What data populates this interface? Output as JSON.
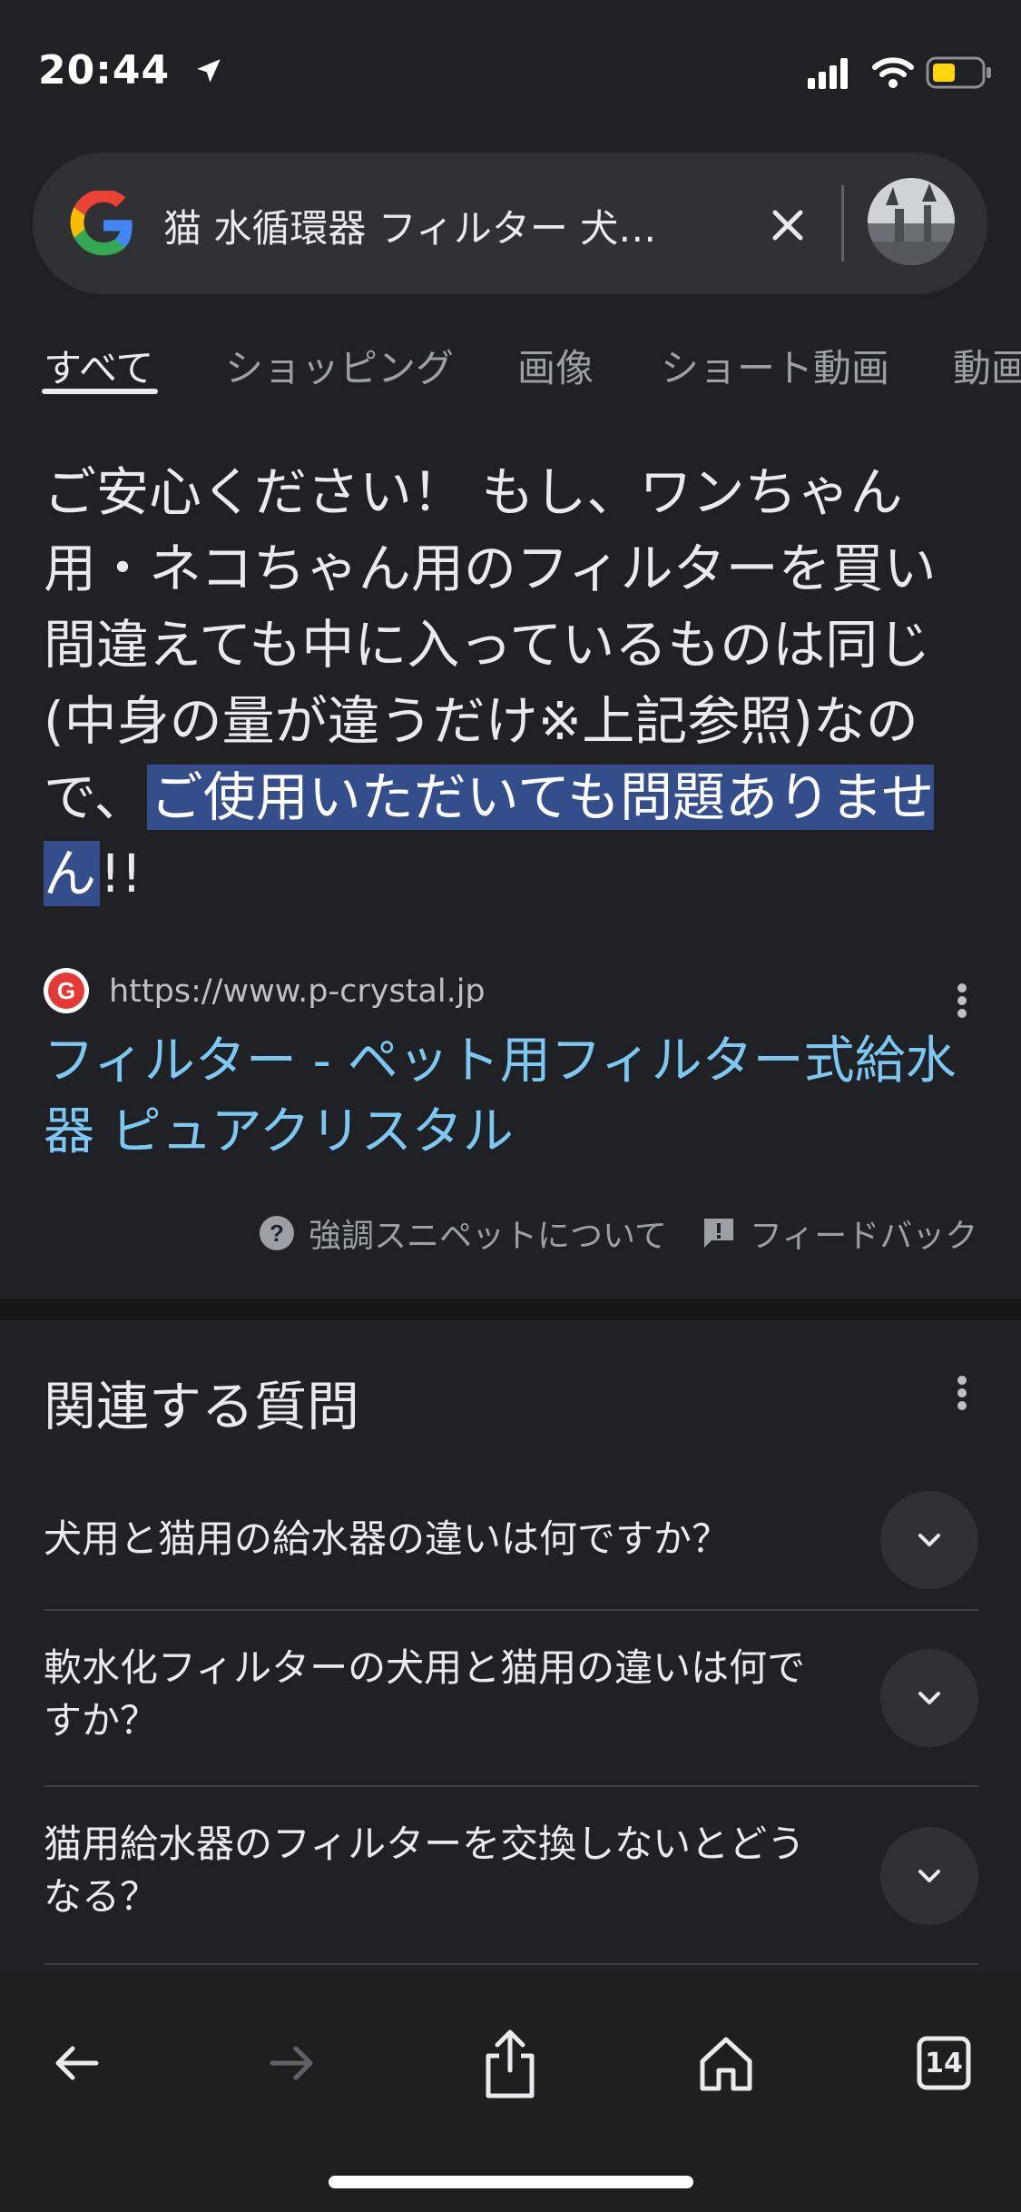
{
  "status": {
    "time": "20:44"
  },
  "search": {
    "query": "猫 水循環器 フィルター 犬…"
  },
  "tabs": [
    "すべて",
    "ショッピング",
    "画像",
    "ショート動画",
    "動画"
  ],
  "snippet": {
    "before": "ご安心ください！ もし、ワンちゃん用・ネコちゃん用のフィルターを買い間違えても中に入っているものは同じ(中身の量が違うだけ※上記参照)なので、",
    "highlight": "ご使用いただいても問題ありません",
    "after": "!!"
  },
  "source": {
    "url": "https://www.p-crystal.jp",
    "title": "フィルター - ペット用フィルター式給水器 ピュアクリスタル"
  },
  "snippet_footer": {
    "about": "強調スニペットについて",
    "feedback": "フィードバック"
  },
  "related": {
    "title": "関連する質問",
    "questions": [
      "犬用と猫用の給水器の違いは何ですか？",
      "軟水化フィルターの犬用と猫用の違いは何ですか？",
      "猫用給水器のフィルターを交換しないとどうなる？"
    ]
  },
  "toolbar": {
    "tab_count": "14"
  },
  "colors": {
    "background": "#202124",
    "link": "#7cc8f3",
    "highlight": "#344e8c"
  }
}
